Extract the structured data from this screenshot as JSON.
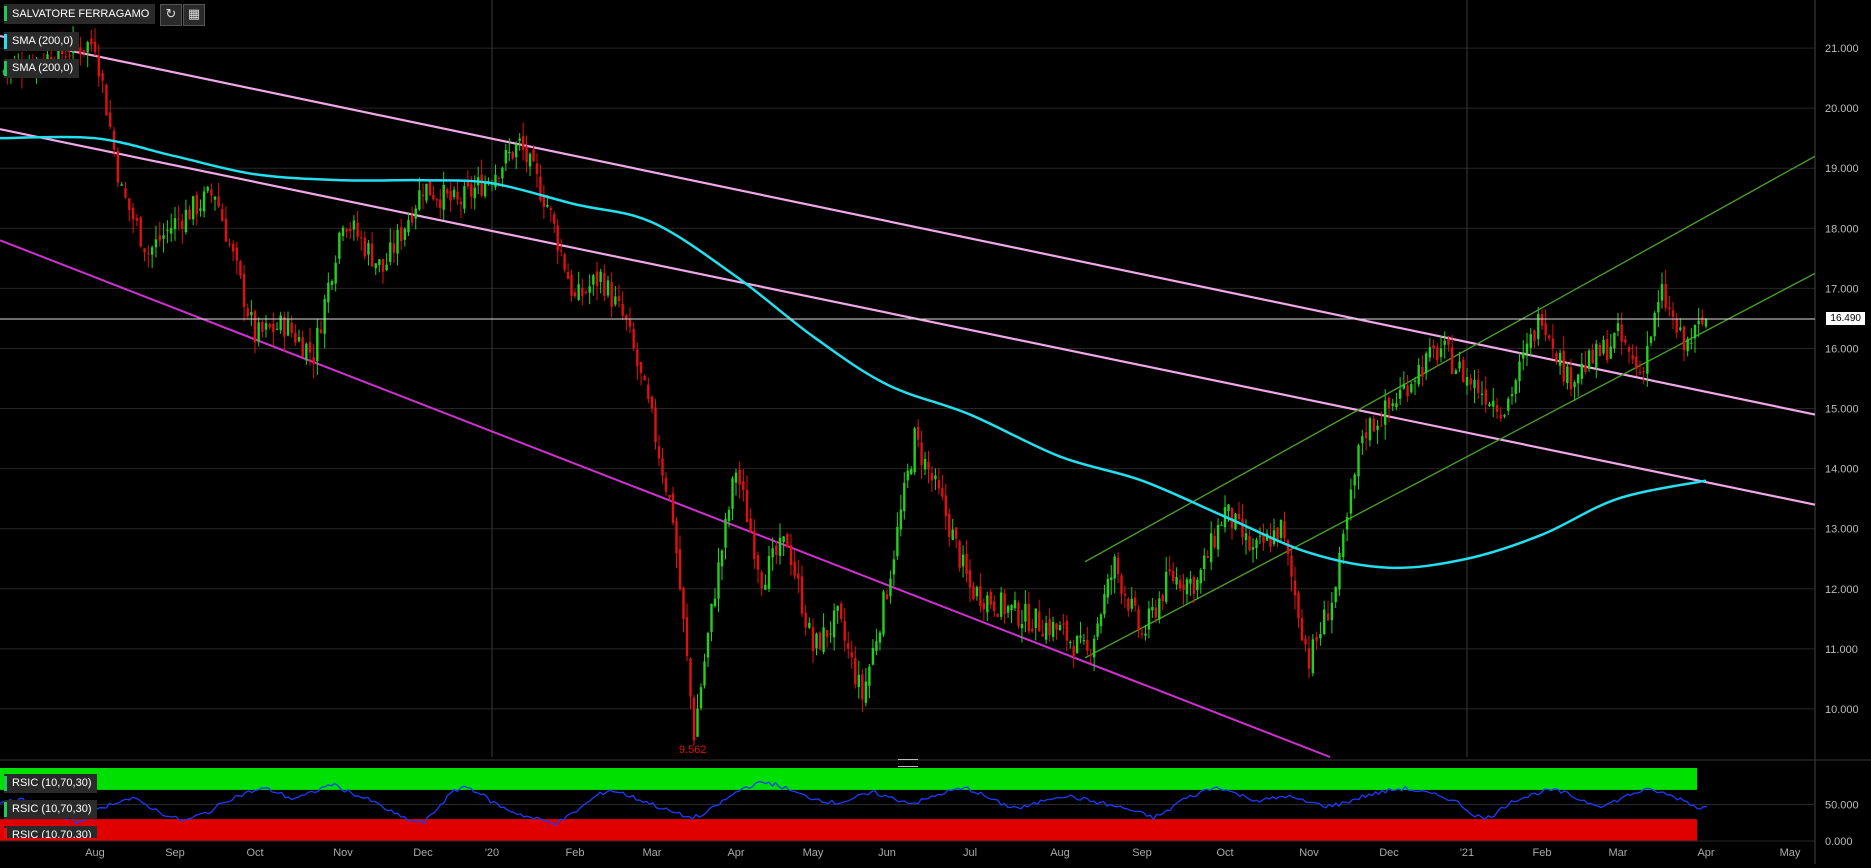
{
  "toolbar": {
    "symbol_label": "SALVATORE FERRAGAMO",
    "refresh_icon": "refresh-icon",
    "calendar_icon": "calendar-icon"
  },
  "indicator_tags": [
    {
      "label": "SMA (200,0)"
    },
    {
      "label": "SMA (200,0)"
    }
  ],
  "rsi_tags": [
    {
      "label": "RSIC (10,70,30)"
    },
    {
      "label": "RSIC (10,70,30)"
    },
    {
      "label": "RSIC (10,70,30)"
    }
  ],
  "colors": {
    "background": "#000000",
    "candle_up": "#22d11c",
    "candle_down": "#e01010",
    "sma": "#22e0f0",
    "trendline_pink": "#f0a8e8",
    "trendline_magenta": "#d030d0",
    "channel_green": "#4a9a2a",
    "rsi_line": "#1a3cff",
    "rsi_overbought": "#00e000",
    "rsi_oversold": "#e00000"
  },
  "chart_data": [
    {
      "type": "candlestick",
      "title": "SALVATORE FERRAGAMO",
      "x_tick_labels": [
        "Aug",
        "Sep",
        "Oct",
        "Nov",
        "Dec",
        "'20",
        "Feb",
        "Mar",
        "Apr",
        "May",
        "Jun",
        "Jul",
        "Aug",
        "Sep",
        "Oct",
        "Nov",
        "Dec",
        "'21",
        "Feb",
        "Mar",
        "Apr",
        "May"
      ],
      "y_tick_labels": [
        "21.000",
        "20.000",
        "19.000",
        "18.000",
        "17.000",
        "16.000",
        "15.000",
        "14.000",
        "13.000",
        "12.000",
        "11.000",
        "10.000"
      ],
      "ylim": [
        9.2,
        21.8
      ],
      "last_price_label": "16.490",
      "last_price": 16.49,
      "low_annotation": "9.562",
      "grid": true,
      "series": [
        {
          "name": "SMA (200,0)",
          "type": "line"
        },
        {
          "name": "SMA (200,0)",
          "type": "line"
        }
      ],
      "close_keypoints": [
        {
          "x": "Jul",
          "y": 20.6
        },
        {
          "x": "Aug",
          "y": 21.1
        },
        {
          "x": "Aug",
          "y": 18.6
        },
        {
          "x": "Aug",
          "y": 17.6
        },
        {
          "x": "Sep",
          "y": 18.1
        },
        {
          "x": "Sep",
          "y": 18.6
        },
        {
          "x": "Oct",
          "y": 16.2
        },
        {
          "x": "Oct",
          "y": 16.4
        },
        {
          "x": "Oct",
          "y": 15.9
        },
        {
          "x": "Nov",
          "y": 18.2
        },
        {
          "x": "Nov",
          "y": 17.3
        },
        {
          "x": "Dec",
          "y": 18.7
        },
        {
          "x": "Dec",
          "y": 18.4
        },
        {
          "x": "'20",
          "y": 18.9
        },
        {
          "x": "'20",
          "y": 19.4
        },
        {
          "x": "'20",
          "y": 18.4
        },
        {
          "x": "Feb",
          "y": 16.8
        },
        {
          "x": "Feb",
          "y": 17.2
        },
        {
          "x": "Feb",
          "y": 16.4
        },
        {
          "x": "Mar",
          "y": 14.8
        },
        {
          "x": "Mar",
          "y": 13.2
        },
        {
          "x": "Mar",
          "y": 9.6
        },
        {
          "x": "Mar",
          "y": 12.0
        },
        {
          "x": "Apr",
          "y": 14.0
        },
        {
          "x": "Apr",
          "y": 12.2
        },
        {
          "x": "Apr",
          "y": 12.8
        },
        {
          "x": "May",
          "y": 11.0
        },
        {
          "x": "May",
          "y": 11.5
        },
        {
          "x": "May",
          "y": 10.2
        },
        {
          "x": "Jun",
          "y": 12.0
        },
        {
          "x": "Jun",
          "y": 14.5
        },
        {
          "x": "Jun",
          "y": 13.4
        },
        {
          "x": "Jul",
          "y": 12.0
        },
        {
          "x": "Jul",
          "y": 11.6
        },
        {
          "x": "Aug",
          "y": 11.3
        },
        {
          "x": "Aug",
          "y": 10.9
        },
        {
          "x": "Aug",
          "y": 12.4
        },
        {
          "x": "Sep",
          "y": 11.2
        },
        {
          "x": "Sep",
          "y": 12.2
        },
        {
          "x": "Sep",
          "y": 12.1
        },
        {
          "x": "Oct",
          "y": 13.3
        },
        {
          "x": "Oct",
          "y": 12.6
        },
        {
          "x": "Oct",
          "y": 13.0
        },
        {
          "x": "Nov",
          "y": 10.8
        },
        {
          "x": "Nov",
          "y": 12.0
        },
        {
          "x": "Nov",
          "y": 14.6
        },
        {
          "x": "Dec",
          "y": 15.0
        },
        {
          "x": "Dec",
          "y": 15.6
        },
        {
          "x": "Dec",
          "y": 16.0
        },
        {
          "x": "'21",
          "y": 15.5
        },
        {
          "x": "'21",
          "y": 15.0
        },
        {
          "x": "Feb",
          "y": 16.6
        },
        {
          "x": "Feb",
          "y": 15.5
        },
        {
          "x": "Feb",
          "y": 15.8
        },
        {
          "x": "Mar",
          "y": 16.2
        },
        {
          "x": "Mar",
          "y": 15.6
        },
        {
          "x": "Mar",
          "y": 16.9
        },
        {
          "x": "Mar",
          "y": 16.0
        },
        {
          "x": "Apr",
          "y": 16.49
        }
      ],
      "sma_keypoints": [
        {
          "x": "Jul",
          "y": 19.5
        },
        {
          "x": "Aug",
          "y": 19.5
        },
        {
          "x": "Sep",
          "y": 19.2
        },
        {
          "x": "Oct",
          "y": 18.9
        },
        {
          "x": "Nov",
          "y": 18.8
        },
        {
          "x": "Dec",
          "y": 18.8
        },
        {
          "x": "'20",
          "y": 18.75
        },
        {
          "x": "Feb",
          "y": 18.4
        },
        {
          "x": "Mar",
          "y": 18.1
        },
        {
          "x": "Apr",
          "y": 17.2
        },
        {
          "x": "May",
          "y": 16.2
        },
        {
          "x": "Jun",
          "y": 15.4
        },
        {
          "x": "Jul",
          "y": 14.9
        },
        {
          "x": "Aug",
          "y": 14.2
        },
        {
          "x": "Sep",
          "y": 13.8
        },
        {
          "x": "Oct",
          "y": 13.2
        },
        {
          "x": "Nov",
          "y": 12.6
        },
        {
          "x": "Dec",
          "y": 12.35
        },
        {
          "x": "'21",
          "y": 12.5
        },
        {
          "x": "Feb",
          "y": 12.9
        },
        {
          "x": "Mar",
          "y": 13.5
        },
        {
          "x": "Apr",
          "y": 13.8
        }
      ],
      "trendlines": [
        {
          "name": "upper-resistance",
          "from": {
            "x": "Jul",
            "y": 21.2
          },
          "to": {
            "x": "May",
            "y": 14.9
          }
        },
        {
          "name": "middle-resistance",
          "from": {
            "x": "Jul",
            "y": 19.65
          },
          "to": {
            "x": "May",
            "y": 13.4
          }
        },
        {
          "name": "lower-support",
          "from": {
            "x": "Jul",
            "y": 17.8
          },
          "to": {
            "x": "Nov",
            "y": 9.2
          }
        },
        {
          "name": "channel-upper",
          "from": {
            "x": "Aug",
            "y": 12.45
          },
          "to": {
            "x": "May",
            "y": 19.2
          }
        },
        {
          "name": "channel-lower",
          "from": {
            "x": "Aug",
            "y": 10.85
          },
          "to": {
            "x": "May",
            "y": 17.25
          }
        }
      ]
    },
    {
      "type": "line",
      "title": "RSIC (10,70,30)",
      "y_tick_labels": [
        "50.000",
        "0.000"
      ],
      "ylim": [
        0,
        100
      ],
      "overbought": 70,
      "oversold": 30,
      "series": [
        {
          "name": "RSIC (10,70,30)",
          "values": [
            52,
            58,
            54,
            47,
            38,
            30,
            25,
            38,
            48,
            55,
            58,
            50,
            40,
            32,
            28,
            35,
            42,
            55,
            62,
            68,
            72,
            66,
            58,
            62,
            70,
            78,
            70,
            62,
            55,
            45,
            35,
            28,
            25,
            45,
            65,
            75,
            68,
            55,
            45,
            38,
            32,
            28,
            25,
            35,
            48,
            62,
            70,
            65,
            58,
            52,
            44,
            38,
            32,
            35,
            48,
            60,
            72,
            78,
            80,
            74,
            66,
            60,
            56,
            52,
            56,
            62,
            66,
            60,
            55,
            52,
            58,
            65,
            70,
            72,
            64,
            55,
            48,
            45,
            50,
            58,
            62,
            60,
            56,
            52,
            48,
            44,
            38,
            32,
            40,
            55,
            62,
            70,
            74,
            66,
            60,
            55,
            58,
            62,
            56,
            52,
            48,
            50,
            56,
            62,
            66,
            70,
            72,
            68,
            64,
            60,
            52,
            38,
            30,
            40,
            55,
            60,
            66,
            70,
            66,
            58,
            52,
            48,
            56,
            64,
            70,
            68,
            62,
            56,
            46
          ]
        }
      ]
    }
  ]
}
